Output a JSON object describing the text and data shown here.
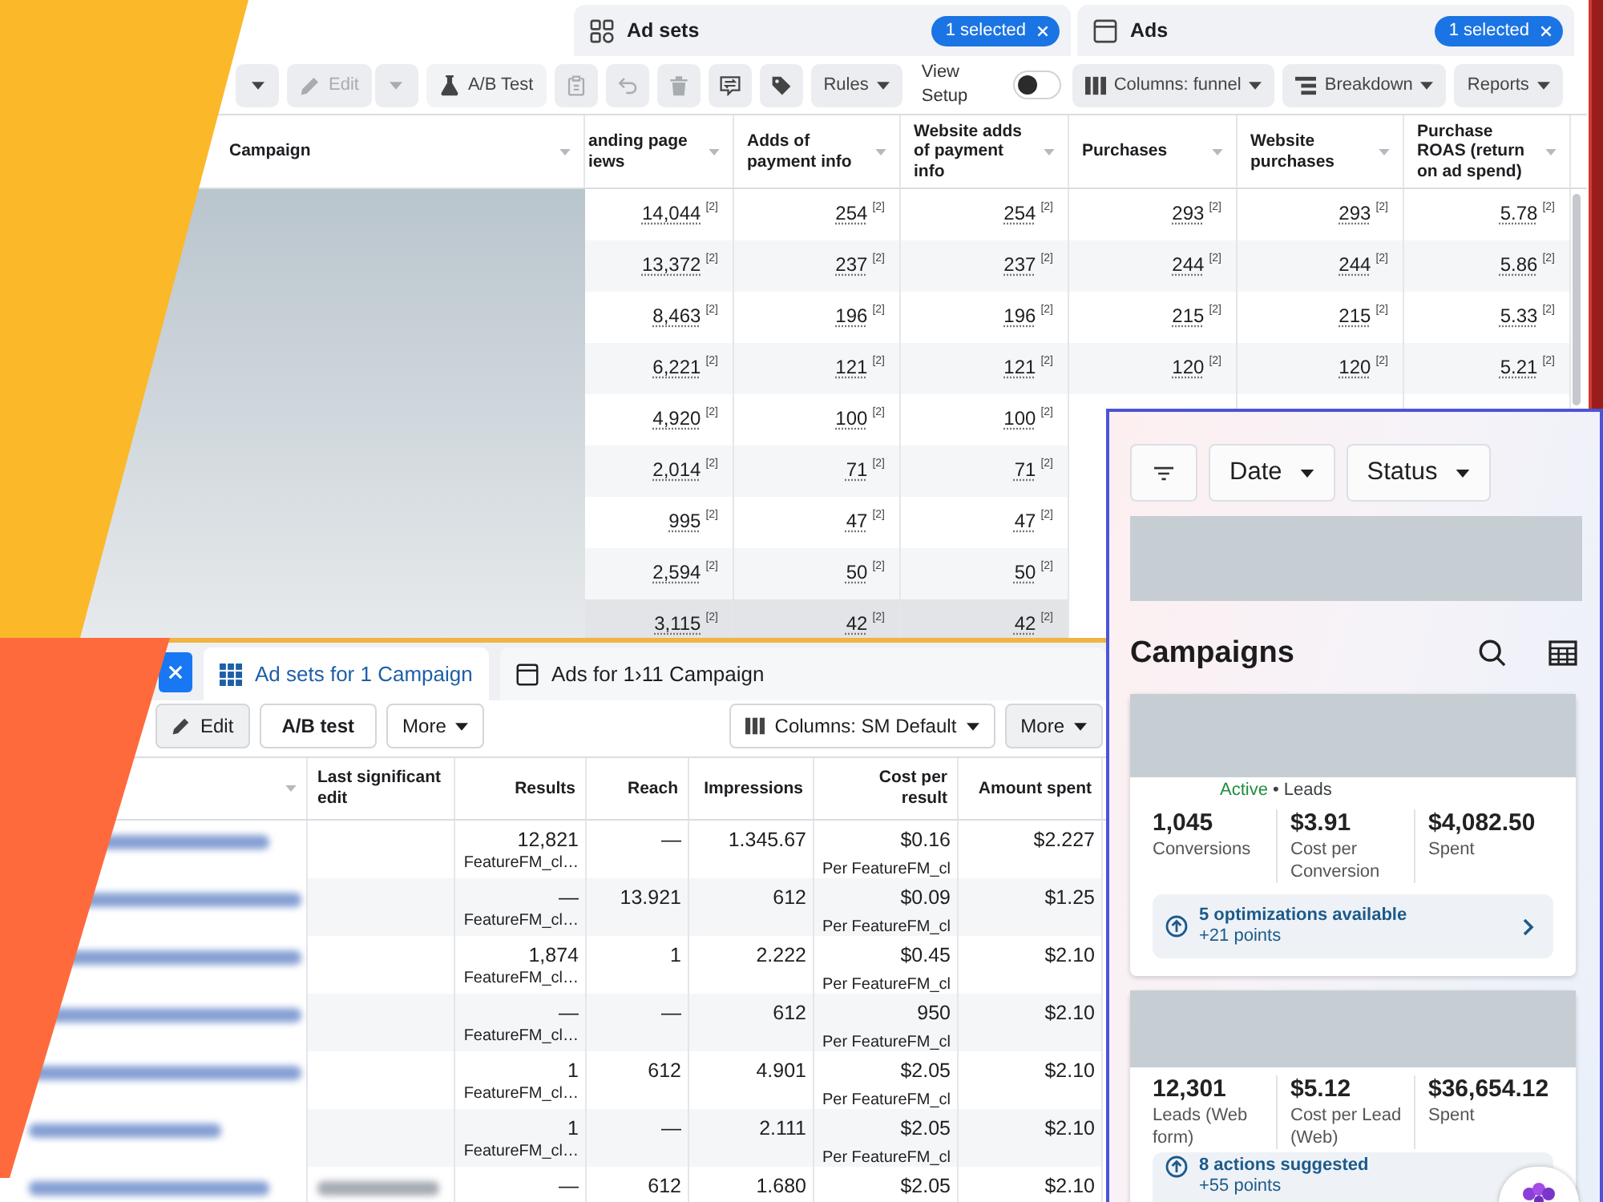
{
  "top_panel": {
    "tabs": [
      {
        "label": "Ad sets",
        "badge": "1 selected",
        "selected": false
      },
      {
        "label": "Ads",
        "badge": "1 selected",
        "selected": false
      }
    ],
    "toolbar": [
      {
        "kind": "caret",
        "disabled": false
      },
      {
        "kind": "edit",
        "label": "Edit",
        "disabled": true
      },
      {
        "kind": "caret",
        "disabled": true
      },
      {
        "kind": "flask",
        "label": "A/B Test",
        "disabled": false
      },
      {
        "kind": "clipboard",
        "disabled": true
      },
      {
        "kind": "undo",
        "disabled": true
      },
      {
        "kind": "trash",
        "disabled": true
      },
      {
        "kind": "swap",
        "disabled": false
      },
      {
        "kind": "tag",
        "disabled": false
      },
      {
        "kind": "menu",
        "label": "Rules",
        "disabled": false
      },
      {
        "kind": "toggle",
        "label": "View Setup",
        "on": false
      },
      {
        "kind": "columns",
        "label": "Columns: funnel",
        "disabled": false
      },
      {
        "kind": "breakdown",
        "label": "Breakdown",
        "disabled": false
      },
      {
        "kind": "menu",
        "label": "Reports",
        "disabled": false
      }
    ],
    "table": {
      "columns": [
        "Campaign",
        "anding page iews",
        "Adds of payment info",
        "Website adds of payment info",
        "Purchases",
        "Website purchases",
        "Purchase ROAS (return on ad spend)"
      ],
      "rows": [
        {
          "selected": false,
          "cells": [
            "14,044$^{[2]}$",
            "254$^{[2]}$",
            "254$^{[2]}$",
            "293$^{[2]}$",
            "293$^{[2]}$",
            "5.78$^{[2]}$"
          ]
        },
        {
          "selected": false,
          "cells": [
            "13,372$^{[2]}$",
            "237$^{[2]}$",
            "237$^{[2]}$",
            "244$^{[2]}$",
            "244$^{[2]}$",
            "5.86$^{[2]}$"
          ]
        },
        {
          "selected": false,
          "cells": [
            "8,463$^{[2]}$",
            "196$^{[2]}$",
            "196$^{[2]}$",
            "215$^{[2]}$",
            "215$^{[2]}$",
            "5.33$^{[2]}$"
          ]
        },
        {
          "selected": false,
          "cells": [
            "6,221$^{[2]}$",
            "121$^{[2]}$",
            "121$^{[2]}$",
            "120$^{[2]}$",
            "120$^{[2]}$",
            "5.21$^{[2]}$"
          ]
        },
        {
          "selected": false,
          "cells": [
            "4,920$^{[2]}$",
            "100$^{[2]}$",
            "100$^{[2]}$"
          ]
        },
        {
          "selected": false,
          "cells": [
            "2,014$^{[2]}$",
            "71$^{[2]}$",
            "71$^{[2]}$"
          ]
        },
        {
          "selected": false,
          "cells": [
            "995$^{[2]}$",
            "47$^{[2]}$",
            "47$^{[2]}$"
          ]
        },
        {
          "selected": false,
          "cells": [
            "2,594$^{[2]}$",
            "50$^{[2]}$",
            "50$^{[2]}$"
          ]
        },
        {
          "selected": true,
          "cells": [
            "3,115$^{[2]}$",
            "42$^{[2]}$",
            "42$^{[2]}$"
          ]
        }
      ]
    }
  },
  "bottom_panel": {
    "tabs": [
      {
        "label": "Ad sets for 1 Campaign",
        "selected": true
      },
      {
        "label": "Ads for 1›11 Campaign",
        "selected": false
      }
    ],
    "toolbar": [
      {
        "kind": "edit",
        "label": "Edit"
      },
      {
        "kind": "plain",
        "label": "A/B test"
      },
      {
        "kind": "menu",
        "label": "More"
      },
      {
        "kind": "columns",
        "label": "Columns: SM Default"
      },
      {
        "kind": "overflow",
        "label": "More"
      }
    ],
    "table": {
      "columns": [
        "Last significant edit",
        "Results",
        "Reach",
        "Impressions",
        "Cost per result",
        "Amount spent"
      ],
      "rows": [
        {
          "cells": [
            {
              "blurred": false
            },
            {
              "value": "12,821",
              "note": "FeatureFM_cl…"
            },
            {
              "value": "—"
            },
            {
              "value": "1.345.67"
            },
            {
              "value": "$0.16",
              "note": "Per FeatureFM_cl"
            },
            {
              "value": "$2.227"
            }
          ]
        },
        {
          "cells": [
            {
              "blurred": false
            },
            {
              "value": "—",
              "note": "FeatureFM_cl…"
            },
            {
              "value": "13.921"
            },
            {
              "value": "612"
            },
            {
              "value": "$0.09",
              "note": "Per FeatureFM_cl"
            },
            {
              "value": "$1.25"
            }
          ]
        },
        {
          "cells": [
            {
              "blurred": false
            },
            {
              "value": "1,874",
              "note": "FeatureFM_cl…"
            },
            {
              "value": "1"
            },
            {
              "value": "2.222"
            },
            {
              "value": "$0.45",
              "note": "Per FeatureFM_cl"
            },
            {
              "value": "$2.10"
            }
          ]
        },
        {
          "cells": [
            {
              "blurred": false
            },
            {
              "value": "—",
              "note": "FeatureFM_cl…"
            },
            {
              "value": "—"
            },
            {
              "value": "612"
            },
            {
              "value": "950",
              "note": "Per FeatureFM_cl"
            },
            {
              "value": "$2.10"
            }
          ]
        },
        {
          "cells": [
            {
              "blurred": false
            },
            {
              "value": "1",
              "note": "FeatureFM_cl…"
            },
            {
              "value": "612"
            },
            {
              "value": "4.901"
            },
            {
              "value": "$2.05",
              "note": "Per FeatureFM_cl"
            },
            {
              "value": "$2.10"
            }
          ]
        },
        {
          "cells": [
            {
              "blurred": false
            },
            {
              "value": "1",
              "note": "FeatureFM_cl…"
            },
            {
              "value": "—"
            },
            {
              "value": "2.111"
            },
            {
              "value": "$2.05",
              "note": "Per FeatureFM_cl"
            },
            {
              "value": "$2.10"
            }
          ]
        },
        {
          "cells": [
            {
              "blurred": true
            },
            {
              "value": "—"
            },
            {
              "value": "612"
            },
            {
              "value": "1.680"
            },
            {
              "value": "$2.05"
            },
            {
              "value": "$2.10"
            }
          ]
        }
      ]
    }
  },
  "phone": {
    "filters": [
      {
        "kind": "filter"
      },
      {
        "kind": "menu",
        "label": "Date"
      },
      {
        "kind": "menu",
        "label": "Status"
      }
    ],
    "heading": "Campaigns",
    "campaigns": [
      {
        "status": "Active",
        "active": true,
        "type": "• Leads",
        "metrics": [
          {
            "value": "1,045",
            "label": "Conversions"
          },
          {
            "value": "$3.91",
            "label": "Cost per Conversion"
          },
          {
            "value": "$4,082.50",
            "label": "Spent"
          }
        ],
        "suggestion": {
          "title": "5 optimizations available",
          "points": "+21 points",
          "chevron": true
        }
      },
      {
        "metrics": [
          {
            "value": "12,301",
            "label": "Leads (Web form)"
          },
          {
            "value": "$5.12",
            "label": "Cost per Lead (Web)"
          },
          {
            "value": "$36,654.12",
            "label": "Spent"
          }
        ],
        "suggestion": {
          "title": "8 actions suggested",
          "points": "+55 points",
          "chevron": false
        }
      }
    ]
  }
}
